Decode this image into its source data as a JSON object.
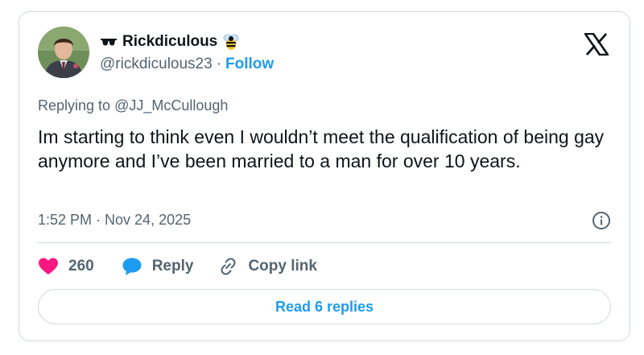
{
  "author": {
    "display_name": "Rickdiculous",
    "handle": "@rickdiculous23",
    "separator": "·",
    "follow_label": "Follow",
    "leading_emoji": "sunglasses-icon",
    "trailing_emoji": "bee-icon"
  },
  "reply_context": {
    "prefix": "Replying to",
    "mention": "@JJ_McCullough"
  },
  "tweet": {
    "text": "Im starting to think even I wouldn’t meet the qualification of being gay anymore and I’ve been married to a man for over 10 years.",
    "timestamp": "1:52 PM · Nov 24, 2025"
  },
  "actions": {
    "likes": "260",
    "reply_label": "Reply",
    "copy_link_label": "Copy link"
  },
  "replies_button": "Read 6 replies",
  "colors": {
    "accent": "#1d9bf0",
    "like": "#f91880",
    "text": "#0f1419",
    "muted": "#536471",
    "border": "#cfd9de"
  }
}
